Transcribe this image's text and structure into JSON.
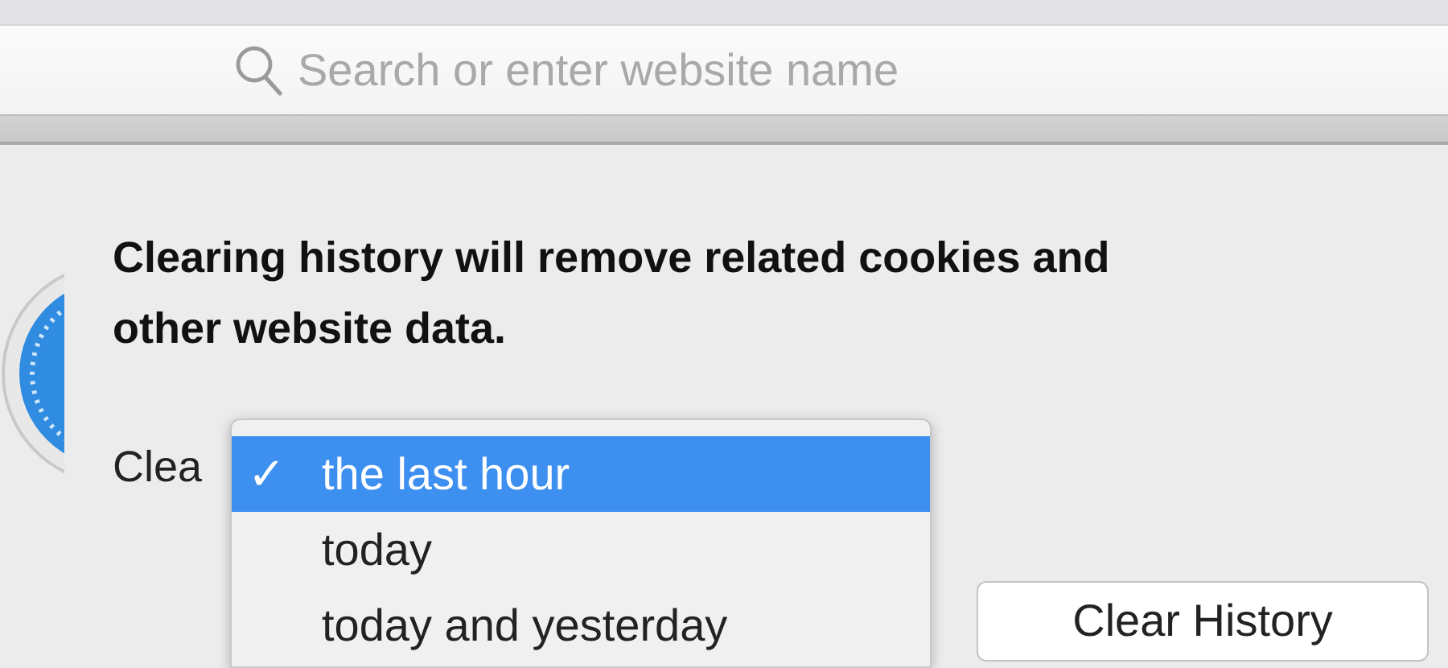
{
  "address_bar": {
    "placeholder": "Search or enter website name"
  },
  "message": "Clearing history will remove related cookies and other website data.",
  "clear_label": "Clea",
  "menu": [
    {
      "label": "the last hour",
      "selected": true,
      "checked": true
    },
    {
      "label": "today",
      "selected": false,
      "checked": false
    },
    {
      "label": "today and yesterday",
      "selected": false,
      "checked": false
    }
  ],
  "check_mark": "✓",
  "buttons": [
    "Clear History"
  ]
}
